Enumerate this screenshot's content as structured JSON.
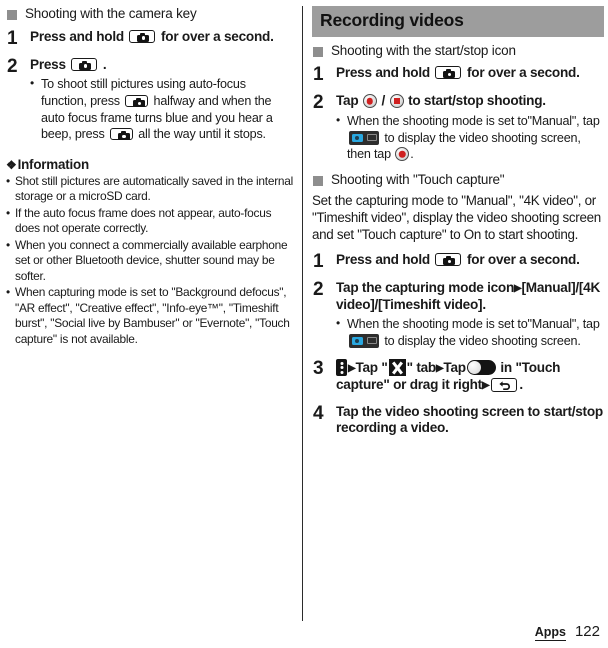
{
  "left_column": {
    "subhead": "Shooting with the camera key",
    "steps": [
      {
        "number": "1",
        "head_before": "Press and hold",
        "head_after": "for over a second.",
        "icon": "camera-key-icon",
        "notes": []
      },
      {
        "number": "2",
        "head_before": "Press",
        "head_after": ".",
        "icon": "camera-key-icon",
        "notes": [
          {
            "part1": "To shoot still pictures using auto-focus function, press",
            "part2": "halfway and when the auto focus frame turns blue and you hear a beep, press",
            "part3": "all the way until it stops."
          }
        ]
      }
    ],
    "information": {
      "title": "Information",
      "diamond": "❖",
      "items": [
        "Shot still pictures are automatically saved in the internal storage or a microSD card.",
        "If the auto focus frame does not appear, auto-focus does not operate correctly.",
        "When you connect a commercially available earphone set or other Bluetooth device, shutter sound may be softer.",
        "When capturing mode is set to \"Background defocus\", \"AR effect\", \"Creative effect\", \"Info-eye™\", \"Timeshift burst\", \"Social live by Bambuser\" or \"Evernote\", \"Touch capture\" is not available."
      ]
    }
  },
  "right_column": {
    "band_title": "Recording videos",
    "section1": {
      "subhead": "Shooting with the start/stop icon",
      "steps": [
        {
          "number": "1",
          "head_before": "Press and hold",
          "head_after": "for over a second.",
          "icon": "camera-key-icon"
        },
        {
          "number": "2",
          "head_before": "Tap",
          "head_middle": "/",
          "head_after": "to start/stop shooting.",
          "icon_record": "record-icon",
          "icon_stop": "stop-icon",
          "note": {
            "part1": "When the shooting mode is set to\"Manual\", tap",
            "part2": "to display the video shooting screen, then tap",
            "part3": "."
          }
        }
      ]
    },
    "section2": {
      "subhead": "Shooting with \"Touch capture\"",
      "paragraph": "Set the capturing mode to \"Manual\", \"4K video\", or \"Timeshift video\", display the video shooting screen and set \"Touch capture\" to On to start shooting.",
      "steps": [
        {
          "number": "1",
          "head_before": "Press and hold",
          "head_after": "for over a second.",
          "icon": "camera-key-icon"
        },
        {
          "number": "2",
          "head_before": "Tap the capturing mode icon",
          "head_arrow": "▶",
          "head_after": "[Manual]/[4K video]/[Timeshift video].",
          "note": {
            "part1": "When the shooting mode is set to\"Manual\", tap",
            "part2": "to display the video shooting screen."
          }
        },
        {
          "number": "3",
          "seg1": "Tap \"",
          "seg2": "\" tab",
          "seg3": "Tap",
          "seg4": "in \"Touch capture\" or drag it right",
          "seg5": ".",
          "arrow": "▶",
          "icon_menu": "vertical-dots-menu-icon",
          "icon_tools": "tools-tab-icon",
          "icon_toggle": "toggle-switch-off-icon",
          "icon_back": "back-key-icon"
        },
        {
          "number": "4",
          "head": "Tap the video shooting screen to start/stop recording a video."
        }
      ]
    }
  },
  "footer": {
    "section_label": "Apps",
    "page_number": "122"
  },
  "colors": {
    "band_background": "#9d9d9d",
    "square_bullet": "#8e8e8e",
    "record_red": "#cf2020",
    "accent_blue": "#2aa8e0",
    "text": "#1a1a1a"
  }
}
